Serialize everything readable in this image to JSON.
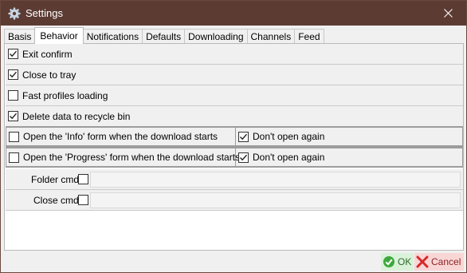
{
  "window": {
    "title": "Settings"
  },
  "tabs": [
    {
      "label": "Basis"
    },
    {
      "label": "Behavior",
      "active": true
    },
    {
      "label": "Notifications"
    },
    {
      "label": "Defaults"
    },
    {
      "label": "Downloading"
    },
    {
      "label": "Channels"
    },
    {
      "label": "Feed"
    }
  ],
  "options": {
    "exit_confirm": {
      "label": "Exit confirm",
      "checked": true
    },
    "close_to_tray": {
      "label": "Close to tray",
      "checked": true
    },
    "fast_profiles": {
      "label": "Fast profiles loading",
      "checked": false
    },
    "delete_recycle": {
      "label": "Delete data to recycle bin",
      "checked": true
    },
    "info_form": {
      "label": "Open the 'Info' form when the download starts",
      "checked": false,
      "dont_open_label": "Don't open again",
      "dont_open_checked": true
    },
    "progress_form": {
      "label": "Open the 'Progress' form when the download starts",
      "checked": false,
      "dont_open_label": "Don't open again",
      "dont_open_checked": true
    }
  },
  "commands": {
    "folder": {
      "label": "Folder cmd",
      "value": ""
    },
    "close": {
      "label": "Close cmd",
      "value": ""
    }
  },
  "buttons": {
    "ok": "OK",
    "cancel": "Cancel"
  },
  "colors": {
    "titlebar": "#5c3b33",
    "ok_bg": "#d9f2d9",
    "cancel_bg": "#f9d6d6"
  },
  "icons": {
    "app": "gear-icon",
    "close": "close-icon",
    "ok": "check-circle-icon",
    "cancel": "x-icon"
  }
}
